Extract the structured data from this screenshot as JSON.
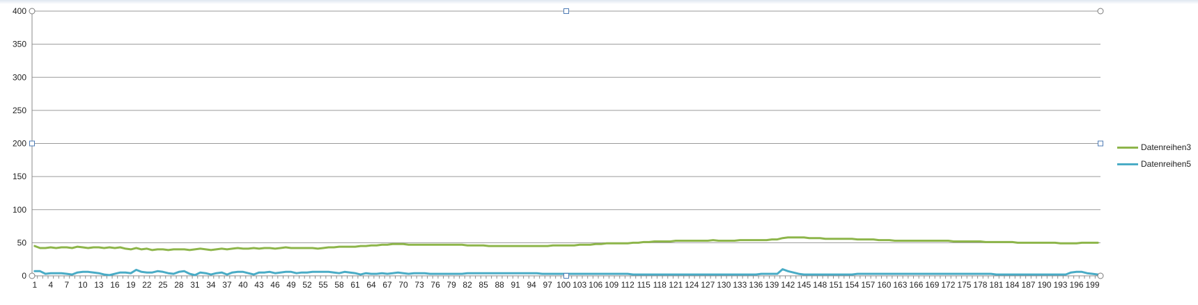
{
  "chart_data": {
    "type": "line",
    "title": "",
    "xlabel": "",
    "ylabel": "",
    "ylim": [
      0,
      400
    ],
    "yticks": [
      0,
      50,
      100,
      150,
      200,
      250,
      300,
      350,
      400
    ],
    "x_count": 200,
    "x_tick_step": 3,
    "grid": true,
    "legend_position": "right",
    "series": [
      {
        "name": "Datenreihen3",
        "color": "#8db54a",
        "values": [
          45,
          42,
          42,
          43,
          42,
          43,
          43,
          42,
          44,
          43,
          42,
          43,
          43,
          42,
          43,
          42,
          43,
          41,
          40,
          42,
          40,
          41,
          39,
          40,
          40,
          39,
          40,
          40,
          40,
          39,
          40,
          41,
          40,
          39,
          40,
          41,
          40,
          41,
          42,
          41,
          41,
          42,
          41,
          42,
          42,
          41,
          42,
          43,
          42,
          42,
          42,
          42,
          42,
          41,
          42,
          43,
          43,
          44,
          44,
          44,
          44,
          45,
          45,
          46,
          46,
          47,
          47,
          48,
          48,
          48,
          47,
          47,
          47,
          47,
          47,
          47,
          47,
          47,
          47,
          47,
          47,
          46,
          46,
          46,
          46,
          45,
          45,
          45,
          45,
          45,
          45,
          45,
          45,
          45,
          45,
          45,
          45,
          46,
          46,
          46,
          46,
          46,
          47,
          47,
          47,
          48,
          48,
          49,
          49,
          49,
          49,
          49,
          50,
          50,
          51,
          51,
          52,
          52,
          52,
          52,
          53,
          53,
          53,
          53,
          53,
          53,
          53,
          54,
          53,
          53,
          53,
          53,
          54,
          54,
          54,
          54,
          54,
          54,
          55,
          55,
          57,
          58,
          58,
          58,
          58,
          57,
          57,
          57,
          56,
          56,
          56,
          56,
          56,
          56,
          55,
          55,
          55,
          55,
          54,
          54,
          54,
          53,
          53,
          53,
          53,
          53,
          53,
          53,
          53,
          53,
          53,
          53,
          52,
          52,
          52,
          52,
          52,
          52,
          51,
          51,
          51,
          51,
          51,
          51,
          50,
          50,
          50,
          50,
          50,
          50,
          50,
          50,
          49,
          49,
          49,
          49,
          50,
          50,
          50,
          50
        ]
      },
      {
        "name": "Datenreihen5",
        "color": "#4aacc6",
        "values": [
          7,
          7,
          3,
          4,
          4,
          4,
          3,
          2,
          5,
          6,
          6,
          5,
          4,
          2,
          1,
          3,
          5,
          5,
          4,
          9,
          6,
          5,
          5,
          7,
          6,
          4,
          3,
          6,
          7,
          3,
          1,
          5,
          4,
          2,
          4,
          5,
          2,
          5,
          6,
          6,
          4,
          2,
          5,
          5,
          6,
          4,
          5,
          6,
          6,
          4,
          5,
          5,
          6,
          6,
          6,
          6,
          5,
          4,
          6,
          5,
          4,
          2,
          4,
          3,
          3,
          4,
          3,
          4,
          5,
          4,
          3,
          4,
          4,
          4,
          3,
          3,
          3,
          3,
          3,
          3,
          3,
          4,
          4,
          4,
          4,
          4,
          4,
          4,
          4,
          4,
          4,
          4,
          4,
          4,
          4,
          3,
          3,
          3,
          3,
          3,
          3,
          3,
          3,
          3,
          3,
          3,
          3,
          3,
          3,
          3,
          3,
          3,
          2,
          2,
          2,
          2,
          2,
          2,
          2,
          2,
          2,
          2,
          2,
          2,
          2,
          2,
          2,
          2,
          2,
          2,
          2,
          2,
          2,
          2,
          2,
          2,
          3,
          3,
          3,
          3,
          10,
          7,
          5,
          3,
          2,
          2,
          2,
          2,
          2,
          2,
          2,
          2,
          2,
          2,
          3,
          3,
          3,
          3,
          3,
          3,
          3,
          3,
          3,
          3,
          3,
          3,
          3,
          3,
          3,
          3,
          3,
          3,
          3,
          3,
          3,
          3,
          3,
          3,
          3,
          3,
          2,
          2,
          2,
          2,
          2,
          2,
          2,
          2,
          2,
          2,
          2,
          2,
          2,
          2,
          5,
          6,
          6,
          4,
          3,
          2
        ]
      }
    ]
  },
  "legend": {
    "items": [
      "Datenreihen3",
      "Datenreihen5"
    ]
  }
}
